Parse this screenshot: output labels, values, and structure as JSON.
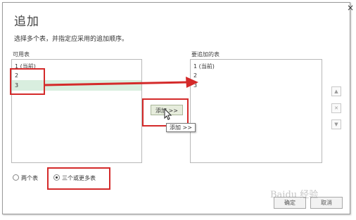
{
  "dialog": {
    "title": "追加",
    "subtitle": "选择多个表，并指定应采用的追加顺序。",
    "close_label": "×"
  },
  "available_tables": {
    "label": "可用表",
    "items": [
      "1 (当前)",
      "2",
      "3"
    ]
  },
  "tables_to_append": {
    "label": "要追加的表",
    "items": [
      "1 (当前)",
      "2",
      "3"
    ]
  },
  "add_button": {
    "label": "添加 >>"
  },
  "tooltip": {
    "text": "添加 >>"
  },
  "side_buttons": [
    {
      "icon": "move-up-icon",
      "glyph": "▲"
    },
    {
      "icon": "remove-icon",
      "glyph": "✕"
    },
    {
      "icon": "move-down-icon",
      "glyph": "▼"
    }
  ],
  "options": {
    "two_tables": "两个表",
    "three_or_more": "三个或更多表",
    "selected": "three_or_more"
  },
  "footer": {
    "ok_label": "确定",
    "cancel_label": "取消"
  },
  "watermark": "Baidu 经验",
  "colors": {
    "highlight": "#d42a2a",
    "selection": "#d9eedf",
    "add_button_bg": "#e6ecdc"
  }
}
